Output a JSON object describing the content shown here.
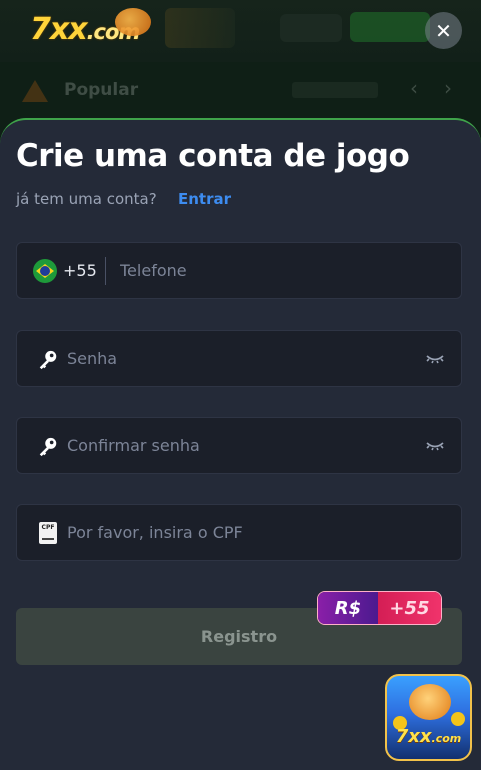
{
  "background": {
    "logo_main": "7xx",
    "logo_suffix": ".com",
    "section_title": "Popular"
  },
  "close": {
    "icon": "close-icon",
    "glyph": "✕"
  },
  "form": {
    "title": "Crie uma conta de jogo",
    "subtitle": "já tem uma conta?",
    "login_link": "Entrar",
    "phone": {
      "country_code": "+55",
      "placeholder": "Telefone",
      "flag": "brazil-flag-icon"
    },
    "password": {
      "placeholder": "Senha"
    },
    "confirm_password": {
      "placeholder": "Confirmar senha"
    },
    "cpf": {
      "placeholder": "Por favor, insira o CPF",
      "icon_label": "CPF"
    },
    "register_label": "Registro",
    "bonus": {
      "currency": "R$",
      "amount": "+55"
    }
  },
  "app_icon": {
    "text_main": "7xx",
    "text_suffix": ".com"
  },
  "colors": {
    "sheet": "#242a38",
    "link": "#3d8cf0",
    "register_disabled": "#3a4440",
    "bonus_left": "#8a1fa8",
    "bonus_right": "#f0336b"
  }
}
